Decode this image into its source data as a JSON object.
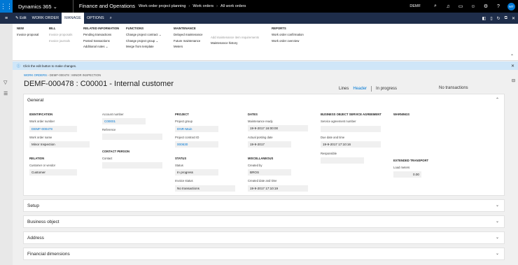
{
  "topbar": {
    "brand": "Dynamics 365",
    "brand_chevron": "⌄",
    "app": "Finance and Operations",
    "breadcrumb": [
      "Work order project planning",
      "Work orders",
      "All work orders"
    ],
    "company": "DEMF",
    "avatar_initials": "MT",
    "icons": [
      "search-icon",
      "bell-icon",
      "chat-icon",
      "smiley-icon",
      "gear-icon",
      "help-icon"
    ]
  },
  "actionbar": {
    "edit": "Edit",
    "work_order": "WORK ORDER",
    "manage": "MANAGE",
    "options": "OPTIONS",
    "search_icon": "⌕"
  },
  "ribbon": {
    "new": {
      "header": "NEW",
      "items": [
        "Invoice proposal"
      ]
    },
    "bill": {
      "header": "BILL",
      "items": [
        "Invoice proposals",
        "Invoice journals"
      ]
    },
    "related": {
      "header": "RELATED INFORMATION",
      "items": [
        "Pending transactions",
        "Posted transactions",
        "Additional notes ⌄"
      ]
    },
    "functions": {
      "header": "FUNCTIONS",
      "items": [
        "Change project contract ⌄",
        "Change project group ⌄",
        "Merge from template"
      ]
    },
    "maintenance": {
      "header": "MAINTENANCE",
      "col1": [
        "Delayed maintenance",
        "Future maintenance",
        "Meters"
      ],
      "col2": [
        "Add maintenance item requirements",
        "Maintenance history"
      ]
    },
    "reports": {
      "header": "REPORTS",
      "items": [
        "Work order confirmation",
        "Work order overview"
      ]
    }
  },
  "message": {
    "text": "Click the edit button to make changes."
  },
  "page": {
    "breadcrumb_link": "WORK ORDERS",
    "breadcrumb_rest": " › DEMF-000478 : MINOR INSPECTION",
    "title": "DEMF-000478 : C00001 - Internal customer",
    "view_lines": "Lines",
    "view_header": "Header",
    "status": "In progress",
    "invoice_status": "No transactions"
  },
  "general": {
    "title": "General",
    "identification": {
      "header": "IDENTIFICATION",
      "work_order_number_label": "Work order number",
      "work_order_number": "DEMF-000478",
      "work_order_name_label": "Work order name",
      "work_order_name": "Minor Inspection"
    },
    "relation": {
      "header": "RELATION",
      "customer_label": "Customer or vendor",
      "customer": "Customer"
    },
    "account": {
      "account_number_label": "Account number",
      "account_number": "C00001",
      "reference_label": "Reference",
      "reference": ""
    },
    "contact": {
      "header": "CONTACT PERSON",
      "contact_label": "Contact",
      "contact": ""
    },
    "project": {
      "header": "PROJECT",
      "project_group_label": "Project group",
      "project_group": "DNR-Main",
      "project_contract_label": "Project contract ID",
      "project_contract": "000630"
    },
    "status": {
      "header": "STATUS",
      "status_label": "Status",
      "status": "In progress",
      "invoice_status_label": "Invoice status",
      "invoice_status": "No transactions"
    },
    "dates": {
      "header": "DATES",
      "maintenance_ready_label": "Maintenance ready",
      "maintenance_ready": "19-9-2017 16:00:00",
      "actual_posting_label": "Actual posting date",
      "actual_posting": "19-9-2017"
    },
    "misc": {
      "header": "MISCELLANEOUS",
      "created_by_label": "Created by",
      "created_by": "BROS",
      "created_date_label": "Created date and time",
      "created_date": "19-9-2017 17:10:19"
    },
    "agreement": {
      "header": "BUSINESS OBJECT SERVICE AGREEMENT",
      "agreement_number_label": "Service agreement number",
      "agreement_number": "",
      "due_date_label": "Due date and time",
      "due_date": "19-9-2017 17:10:16",
      "responsible_label": "Responsible",
      "responsible": ""
    },
    "warnings": {
      "header": "WARNINGS"
    },
    "transport": {
      "header": "EXTENDED TRANSPORT",
      "load_meters_label": "Load meters",
      "load_meters": "0.00"
    }
  },
  "sections": [
    "Setup",
    "Business object",
    "Address",
    "Financial dimensions"
  ]
}
